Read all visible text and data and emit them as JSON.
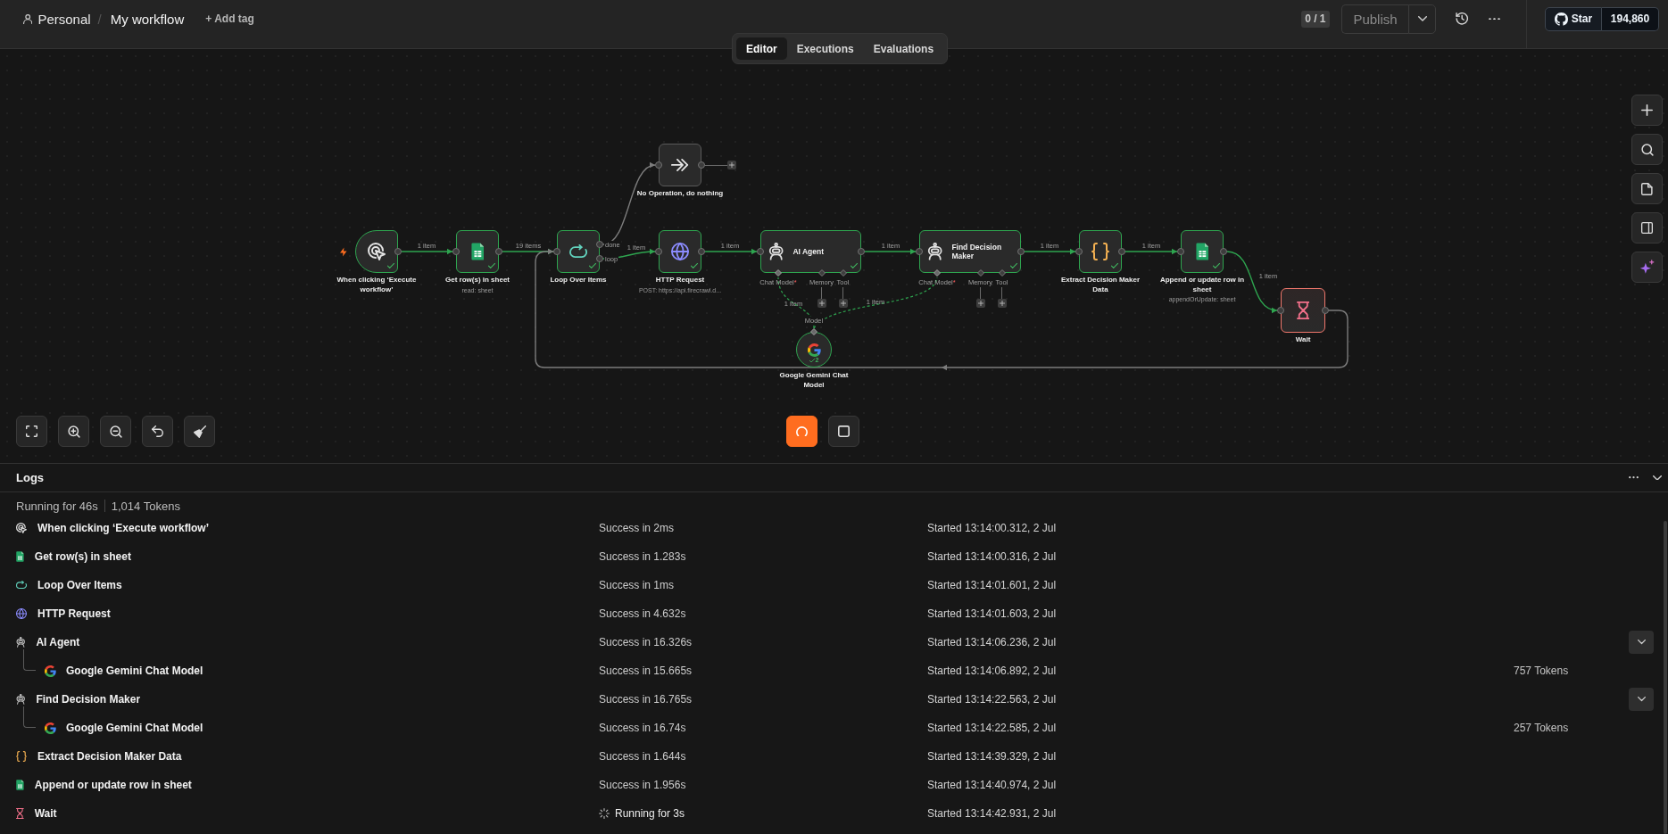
{
  "header": {
    "breadcrumb": {
      "project": "Personal",
      "separator": "/",
      "workflow": "My workflow"
    },
    "add_tag": "+ Add tag",
    "view_tabs": [
      {
        "label": "Editor",
        "selected": true
      },
      {
        "label": "Executions",
        "selected": false
      },
      {
        "label": "Evaluations",
        "selected": false
      }
    ],
    "counter": "0 / 1",
    "publish": {
      "label": "Publish",
      "disabled": true
    },
    "github": {
      "label": "Star",
      "count": "194,860"
    }
  },
  "canvas": {
    "nodes": [
      {
        "kind": "trigger",
        "title": "When clicking ‘Execute workflow’",
        "executed": true,
        "running": false
      },
      {
        "kind": "sheets",
        "title": "Get row(s) in sheet",
        "subtitle": "read: sheet",
        "executed": true,
        "running": false
      },
      {
        "kind": "loop",
        "title": "Loop Over Items",
        "executed": true,
        "running": false,
        "outputs": [
          "done",
          "loop"
        ]
      },
      {
        "kind": "noop",
        "title": "No Operation, do nothing",
        "executed": false,
        "running": false
      },
      {
        "kind": "http",
        "title": "HTTP Request",
        "subtitle": "POST: https://api.firecrawl.d...",
        "executed": true,
        "running": false
      },
      {
        "kind": "agent",
        "title": "AI Agent",
        "executed": true,
        "running": false,
        "connectors": [
          {
            "label": "Chat Model",
            "required_mark": "*",
            "connected": true
          },
          {
            "label": "Memory",
            "connected": false
          },
          {
            "label": "Tool",
            "connected": false
          }
        ]
      },
      {
        "kind": "agent",
        "title": "Find Decision Maker",
        "executed": true,
        "running": false,
        "connectors": [
          {
            "label": "Chat Model",
            "required_mark": "*",
            "connected": true
          },
          {
            "label": "Memory",
            "connected": false
          },
          {
            "label": "Tool",
            "connected": false
          }
        ]
      },
      {
        "kind": "code",
        "title": "Extract Decision Maker Data",
        "executed": true,
        "running": false
      },
      {
        "kind": "sheets",
        "title": "Append or update row in sheet",
        "subtitle": "appendOrUpdate: sheet",
        "executed": true,
        "running": false
      },
      {
        "kind": "wait",
        "title": "Wait",
        "executed": false,
        "running": true
      },
      {
        "kind": "gemini",
        "title": "Google Gemini Chat Model",
        "executed": true,
        "running": false,
        "input_label": "Model",
        "run_count": "2"
      }
    ],
    "edges": [
      {
        "kind": "main",
        "executed": true,
        "label": "1 item"
      },
      {
        "kind": "main",
        "executed": true,
        "label": "19 items"
      },
      {
        "kind": "main",
        "executed": false
      },
      {
        "kind": "main",
        "executed": true,
        "label": "1 item"
      },
      {
        "kind": "main",
        "executed": true,
        "label": "1 item"
      },
      {
        "kind": "main",
        "executed": true,
        "label": "1 item"
      },
      {
        "kind": "main",
        "executed": true,
        "label": "1 item"
      },
      {
        "kind": "main",
        "executed": true,
        "label": "1 item"
      },
      {
        "kind": "main",
        "executed": true,
        "label": "1 item"
      },
      {
        "kind": "main",
        "executed": false
      },
      {
        "kind": "ai",
        "executed": true,
        "label": "1 item"
      },
      {
        "kind": "ai",
        "executed": true,
        "label": "1 item"
      }
    ]
  },
  "logs": {
    "title": "Logs",
    "summary": {
      "duration": "Running for 46s",
      "tokens": "1,014 Tokens"
    },
    "entries": [
      {
        "kind": "trigger",
        "name": "When clicking ‘Execute workflow’",
        "running": false,
        "duration": "Success in 2ms",
        "started": "Started 13:14:00.312, 2 Jul"
      },
      {
        "kind": "sheets",
        "name": "Get row(s) in sheet",
        "running": false,
        "duration": "Success in 1.283s",
        "started": "Started 13:14:00.316, 2 Jul"
      },
      {
        "kind": "loop",
        "name": "Loop Over Items",
        "running": false,
        "duration": "Success in 1ms",
        "started": "Started 13:14:01.601, 2 Jul"
      },
      {
        "kind": "http",
        "name": "HTTP Request",
        "running": false,
        "duration": "Success in 4.632s",
        "started": "Started 13:14:01.603, 2 Jul"
      },
      {
        "kind": "agent",
        "name": "AI Agent",
        "running": false,
        "duration": "Success in 16.326s",
        "started": "Started 13:14:06.236, 2 Jul",
        "expanded": true,
        "children": [
          {
            "kind": "gemini",
            "name": "Google Gemini Chat Model",
            "running": false,
            "duration": "Success in 15.665s",
            "started": "Started 13:14:06.892, 2 Jul",
            "tokens": "757 Tokens"
          }
        ]
      },
      {
        "kind": "agent",
        "name": "Find Decision Maker",
        "running": false,
        "duration": "Success in 16.765s",
        "started": "Started 13:14:22.563, 2 Jul",
        "expanded": true,
        "children": [
          {
            "kind": "gemini",
            "name": "Google Gemini Chat Model",
            "running": false,
            "duration": "Success in 16.74s",
            "started": "Started 13:14:22.585, 2 Jul",
            "tokens": "257 Tokens"
          }
        ]
      },
      {
        "kind": "code",
        "name": "Extract Decision Maker Data",
        "running": false,
        "duration": "Success in 1.644s",
        "started": "Started 13:14:39.329, 2 Jul"
      },
      {
        "kind": "sheets",
        "name": "Append or update row in sheet",
        "running": false,
        "duration": "Success in 1.956s",
        "started": "Started 13:14:40.974, 2 Jul"
      },
      {
        "kind": "wait",
        "name": "Wait",
        "running": true,
        "duration": "Running for 3s",
        "started": "Started 13:14:42.931, 2 Jul"
      }
    ]
  }
}
